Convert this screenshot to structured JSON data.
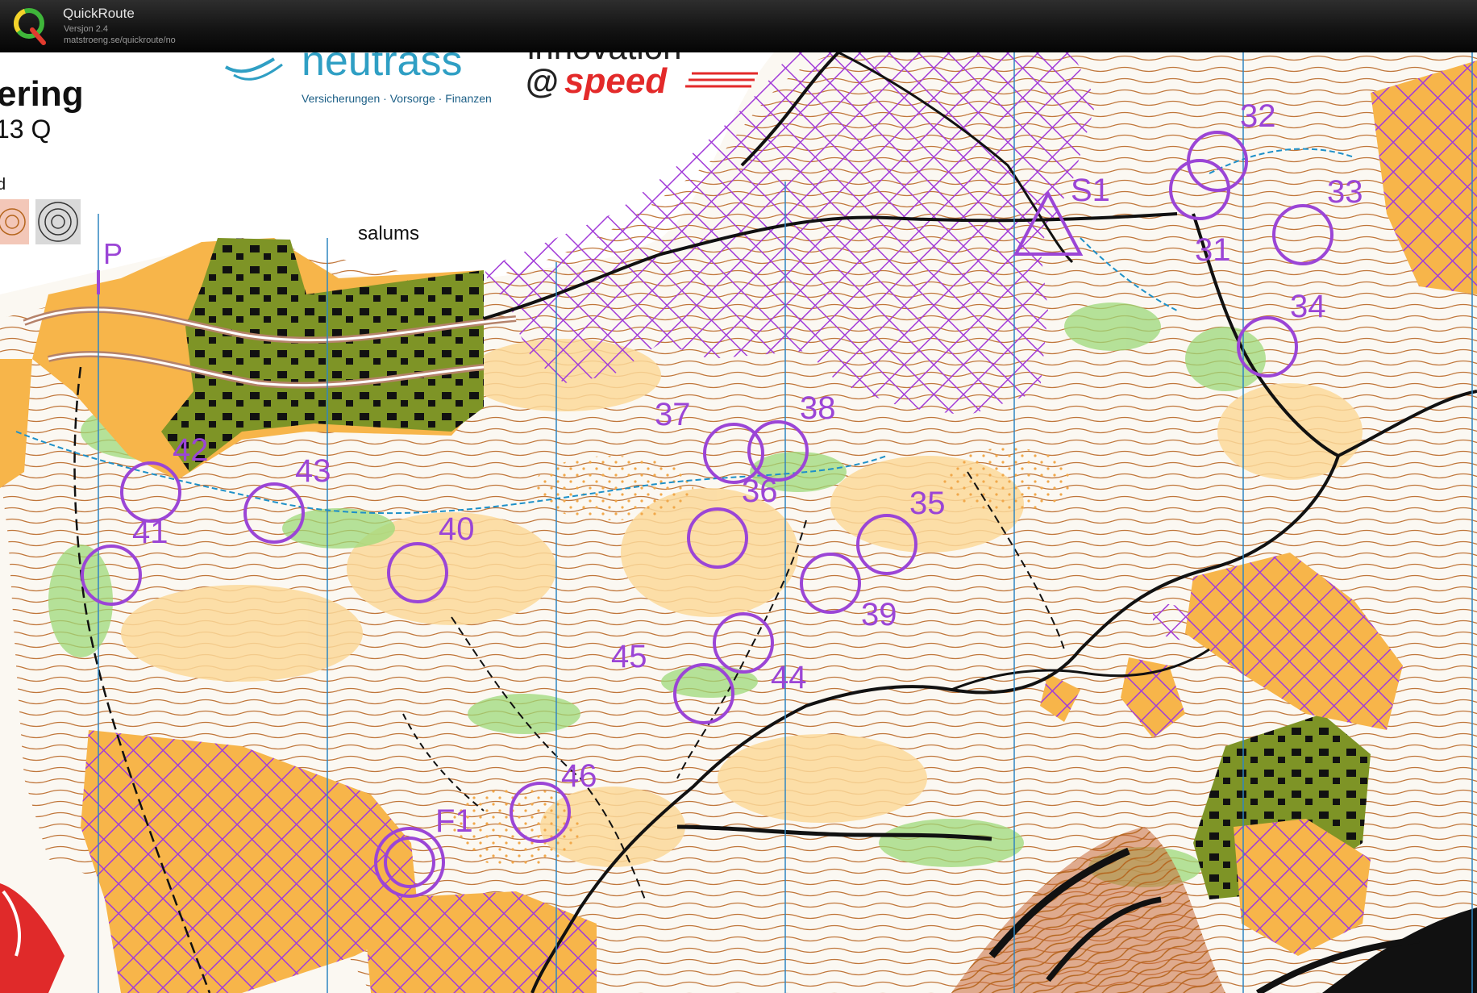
{
  "app": {
    "title": "QuickRoute",
    "version": "Versjon 2.4",
    "url": "matstroeng.se/quickroute/no"
  },
  "map": {
    "colors": {
      "paper": "#fbf8f2",
      "open": "#f7b54a",
      "rough": "#fbd99a",
      "forest_green": "#9dd97a",
      "settlement": "#7e9426",
      "contour": "#b5651d",
      "control": "#9b45d6",
      "water": "#1e90c8",
      "meridian": "#2e86c1",
      "oob": "#a23cd8"
    },
    "header_text": {
      "sponsor": "neutrass",
      "sponsor_tagline": "Versicherungen · Vorsorge · Finanzen",
      "innovation": "innovation",
      "at": "@",
      "speed": "speed",
      "title_fragment": "ering",
      "subtitle_fragment": "13 Q",
      "legend_fragment": "d"
    },
    "place_name": "salums",
    "parking": "P",
    "controls": [
      {
        "label": "S1"
      },
      {
        "label": "31"
      },
      {
        "label": "32"
      },
      {
        "label": "33"
      },
      {
        "label": "34"
      },
      {
        "label": "35"
      },
      {
        "label": "36"
      },
      {
        "label": "37"
      },
      {
        "label": "38"
      },
      {
        "label": "39"
      },
      {
        "label": "40"
      },
      {
        "label": "41"
      },
      {
        "label": "42"
      },
      {
        "label": "43"
      },
      {
        "label": "44"
      },
      {
        "label": "45"
      },
      {
        "label": "46"
      },
      {
        "label": "F1"
      }
    ]
  }
}
